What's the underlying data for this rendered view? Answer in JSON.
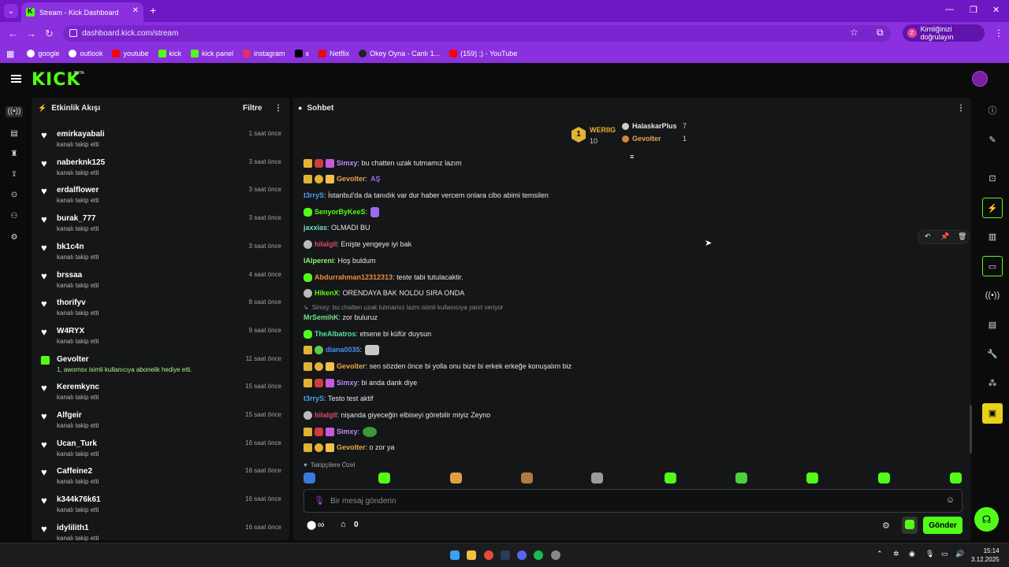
{
  "browser": {
    "tab_title": "Stream - Kick Dashboard",
    "url": "dashboard.kick.com/stream",
    "verify_label": "Kimliğinizi doğrulayın",
    "verify_initial": "Z",
    "bookmarks": [
      "google",
      "outlook",
      "youtube",
      "kick",
      "kick panel",
      "instagram",
      "x",
      "Netflix",
      "Okey Oyna - Canlı 1...",
      "(159) ;) - YouTube"
    ]
  },
  "header": {
    "logo": "KICK",
    "beta": "BETA"
  },
  "activity": {
    "title": "Etkinlik Akışı",
    "filter": "Filtre",
    "items": [
      {
        "name": "emirkayabali",
        "sub": "kanalı takip etti",
        "time": "1 saat önce"
      },
      {
        "name": "naberknk125",
        "sub": "kanalı takip etti",
        "time": "3 saat önce"
      },
      {
        "name": "erdalflower",
        "sub": "kanalı takip etti",
        "time": "3 saat önce"
      },
      {
        "name": "burak_777",
        "sub": "kanalı takip etti",
        "time": "3 saat önce"
      },
      {
        "name": "bk1c4n",
        "sub": "kanalı takip etti",
        "time": "3 saat önce"
      },
      {
        "name": "brssaa",
        "sub": "kanalı takip etti",
        "time": "4 saat önce"
      },
      {
        "name": "thorifyv",
        "sub": "kanalı takip etti",
        "time": "8 saat önce"
      },
      {
        "name": "W4RYX",
        "sub": "kanalı takip etti",
        "time": "9 saat önce"
      },
      {
        "name": "Gevolter",
        "sub": "1, awornsx isimli kullanıcıya abonelik hediye etti.",
        "time": "11 saat önce"
      },
      {
        "name": "Keremkync",
        "sub": "kanalı takip etti",
        "time": "15 saat önce"
      },
      {
        "name": "Alfgeir",
        "sub": "kanalı takip etti",
        "time": "15 saat önce"
      },
      {
        "name": "Ucan_Turk",
        "sub": "kanalı takip etti",
        "time": "16 saat önce"
      },
      {
        "name": "Caffeine2",
        "sub": "kanalı takip etti",
        "time": "16 saat önce"
      },
      {
        "name": "k344k76k61",
        "sub": "kanalı takip etti",
        "time": "16 saat önce"
      },
      {
        "name": "idylilith1",
        "sub": "kanalı takip etti",
        "time": "16 saat önce"
      }
    ]
  },
  "chat": {
    "title": "Sohbet",
    "leaderboard": {
      "first": {
        "name": "WERIIG",
        "rank": "1",
        "count": "10"
      },
      "second": {
        "name": "HalaskarPlus",
        "count": "7"
      },
      "third": {
        "name": "Gevolter",
        "count": "1"
      }
    },
    "messages": [
      {
        "user": "Simxy",
        "text": ": bu chatten uzak tutmamız lazım"
      },
      {
        "user": "Gevolter",
        "text": ":"
      },
      {
        "user": "t3rryS",
        "text": ": İstanbul'da da tanıdık var dur haber vercem onlara cibo abimi temsilen"
      },
      {
        "user": "SenyorByKeeS",
        "text": ":"
      },
      {
        "user": "jaxxias",
        "text": ": OLMADI BU"
      },
      {
        "user": "hilalgll",
        "text": ": Enişte yengeye iyi bak"
      },
      {
        "user": "lAlpereni",
        "text": ": Hoş buldum"
      },
      {
        "user": "Abdurrahman12312313",
        "text": ": teste tabi tutulacaktir."
      },
      {
        "user": "HikenX",
        "text": ": ORENDAYA BAK NOLDU SIRA ONDA"
      },
      {
        "user": "MrSemihK",
        "text": ": zor buluruz"
      },
      {
        "user": "TheAlbatros",
        "text": ": etsene bi küfür duysun"
      },
      {
        "user": "diana0035",
        "text": ":"
      },
      {
        "user": "Gevolter",
        "text": ": sen sözden önce bi yolla onu bize bi erkek erkeğe konuşalım biz"
      },
      {
        "user": "Simxy",
        "text": ": bi anda dank diye"
      },
      {
        "user": "t3rryS",
        "text": ": Testo test aktif"
      },
      {
        "user": "hilalgll",
        "text": ": nişanda giyeceğin elbiseyi görebilir miyiz Zeyno"
      },
      {
        "user": "Simxy",
        "text": ":"
      },
      {
        "user": "Gevolter",
        "text": ": o zor ya"
      }
    ],
    "emote_text": "AŞ",
    "reply_note": "Simxy: bu chatten uzak tutmamız lazm isimli kullanıcıya yanıt veriyor",
    "followers_only": "Takipçilere Özel",
    "input_placeholder": "Bir mesaj gönderin",
    "infinity": "∞",
    "zero_count": "0",
    "send": "Gönder"
  },
  "taskbar": {
    "time": "15:14",
    "date": "3.12.2025"
  },
  "colors": {
    "accent": "#53fc18",
    "browser": "#8a30de",
    "panel": "#151618"
  }
}
